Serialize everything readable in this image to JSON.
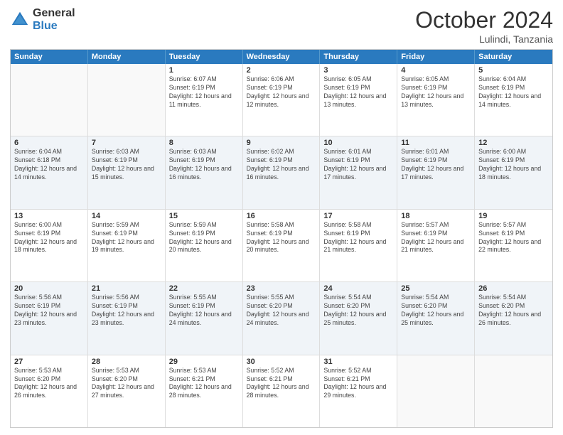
{
  "header": {
    "logo": {
      "general": "General",
      "blue": "Blue"
    },
    "title": "October 2024",
    "subtitle": "Lulindi, Tanzania"
  },
  "weekdays": [
    "Sunday",
    "Monday",
    "Tuesday",
    "Wednesday",
    "Thursday",
    "Friday",
    "Saturday"
  ],
  "rows": [
    [
      {
        "day": "",
        "info": "",
        "empty": true
      },
      {
        "day": "",
        "info": "",
        "empty": true
      },
      {
        "day": "1",
        "info": "Sunrise: 6:07 AM\nSunset: 6:19 PM\nDaylight: 12 hours\nand 11 minutes."
      },
      {
        "day": "2",
        "info": "Sunrise: 6:06 AM\nSunset: 6:19 PM\nDaylight: 12 hours\nand 12 minutes."
      },
      {
        "day": "3",
        "info": "Sunrise: 6:05 AM\nSunset: 6:19 PM\nDaylight: 12 hours\nand 13 minutes."
      },
      {
        "day": "4",
        "info": "Sunrise: 6:05 AM\nSunset: 6:19 PM\nDaylight: 12 hours\nand 13 minutes."
      },
      {
        "day": "5",
        "info": "Sunrise: 6:04 AM\nSunset: 6:19 PM\nDaylight: 12 hours\nand 14 minutes."
      }
    ],
    [
      {
        "day": "6",
        "info": "Sunrise: 6:04 AM\nSunset: 6:18 PM\nDaylight: 12 hours\nand 14 minutes."
      },
      {
        "day": "7",
        "info": "Sunrise: 6:03 AM\nSunset: 6:19 PM\nDaylight: 12 hours\nand 15 minutes."
      },
      {
        "day": "8",
        "info": "Sunrise: 6:03 AM\nSunset: 6:19 PM\nDaylight: 12 hours\nand 16 minutes."
      },
      {
        "day": "9",
        "info": "Sunrise: 6:02 AM\nSunset: 6:19 PM\nDaylight: 12 hours\nand 16 minutes."
      },
      {
        "day": "10",
        "info": "Sunrise: 6:01 AM\nSunset: 6:19 PM\nDaylight: 12 hours\nand 17 minutes."
      },
      {
        "day": "11",
        "info": "Sunrise: 6:01 AM\nSunset: 6:19 PM\nDaylight: 12 hours\nand 17 minutes."
      },
      {
        "day": "12",
        "info": "Sunrise: 6:00 AM\nSunset: 6:19 PM\nDaylight: 12 hours\nand 18 minutes."
      }
    ],
    [
      {
        "day": "13",
        "info": "Sunrise: 6:00 AM\nSunset: 6:19 PM\nDaylight: 12 hours\nand 18 minutes."
      },
      {
        "day": "14",
        "info": "Sunrise: 5:59 AM\nSunset: 6:19 PM\nDaylight: 12 hours\nand 19 minutes."
      },
      {
        "day": "15",
        "info": "Sunrise: 5:59 AM\nSunset: 6:19 PM\nDaylight: 12 hours\nand 20 minutes."
      },
      {
        "day": "16",
        "info": "Sunrise: 5:58 AM\nSunset: 6:19 PM\nDaylight: 12 hours\nand 20 minutes."
      },
      {
        "day": "17",
        "info": "Sunrise: 5:58 AM\nSunset: 6:19 PM\nDaylight: 12 hours\nand 21 minutes."
      },
      {
        "day": "18",
        "info": "Sunrise: 5:57 AM\nSunset: 6:19 PM\nDaylight: 12 hours\nand 21 minutes."
      },
      {
        "day": "19",
        "info": "Sunrise: 5:57 AM\nSunset: 6:19 PM\nDaylight: 12 hours\nand 22 minutes."
      }
    ],
    [
      {
        "day": "20",
        "info": "Sunrise: 5:56 AM\nSunset: 6:19 PM\nDaylight: 12 hours\nand 23 minutes."
      },
      {
        "day": "21",
        "info": "Sunrise: 5:56 AM\nSunset: 6:19 PM\nDaylight: 12 hours\nand 23 minutes."
      },
      {
        "day": "22",
        "info": "Sunrise: 5:55 AM\nSunset: 6:19 PM\nDaylight: 12 hours\nand 24 minutes."
      },
      {
        "day": "23",
        "info": "Sunrise: 5:55 AM\nSunset: 6:20 PM\nDaylight: 12 hours\nand 24 minutes."
      },
      {
        "day": "24",
        "info": "Sunrise: 5:54 AM\nSunset: 6:20 PM\nDaylight: 12 hours\nand 25 minutes."
      },
      {
        "day": "25",
        "info": "Sunrise: 5:54 AM\nSunset: 6:20 PM\nDaylight: 12 hours\nand 25 minutes."
      },
      {
        "day": "26",
        "info": "Sunrise: 5:54 AM\nSunset: 6:20 PM\nDaylight: 12 hours\nand 26 minutes."
      }
    ],
    [
      {
        "day": "27",
        "info": "Sunrise: 5:53 AM\nSunset: 6:20 PM\nDaylight: 12 hours\nand 26 minutes."
      },
      {
        "day": "28",
        "info": "Sunrise: 5:53 AM\nSunset: 6:20 PM\nDaylight: 12 hours\nand 27 minutes."
      },
      {
        "day": "29",
        "info": "Sunrise: 5:53 AM\nSunset: 6:21 PM\nDaylight: 12 hours\nand 28 minutes."
      },
      {
        "day": "30",
        "info": "Sunrise: 5:52 AM\nSunset: 6:21 PM\nDaylight: 12 hours\nand 28 minutes."
      },
      {
        "day": "31",
        "info": "Sunrise: 5:52 AM\nSunset: 6:21 PM\nDaylight: 12 hours\nand 29 minutes."
      },
      {
        "day": "",
        "info": "",
        "empty": true
      },
      {
        "day": "",
        "info": "",
        "empty": true
      }
    ]
  ]
}
